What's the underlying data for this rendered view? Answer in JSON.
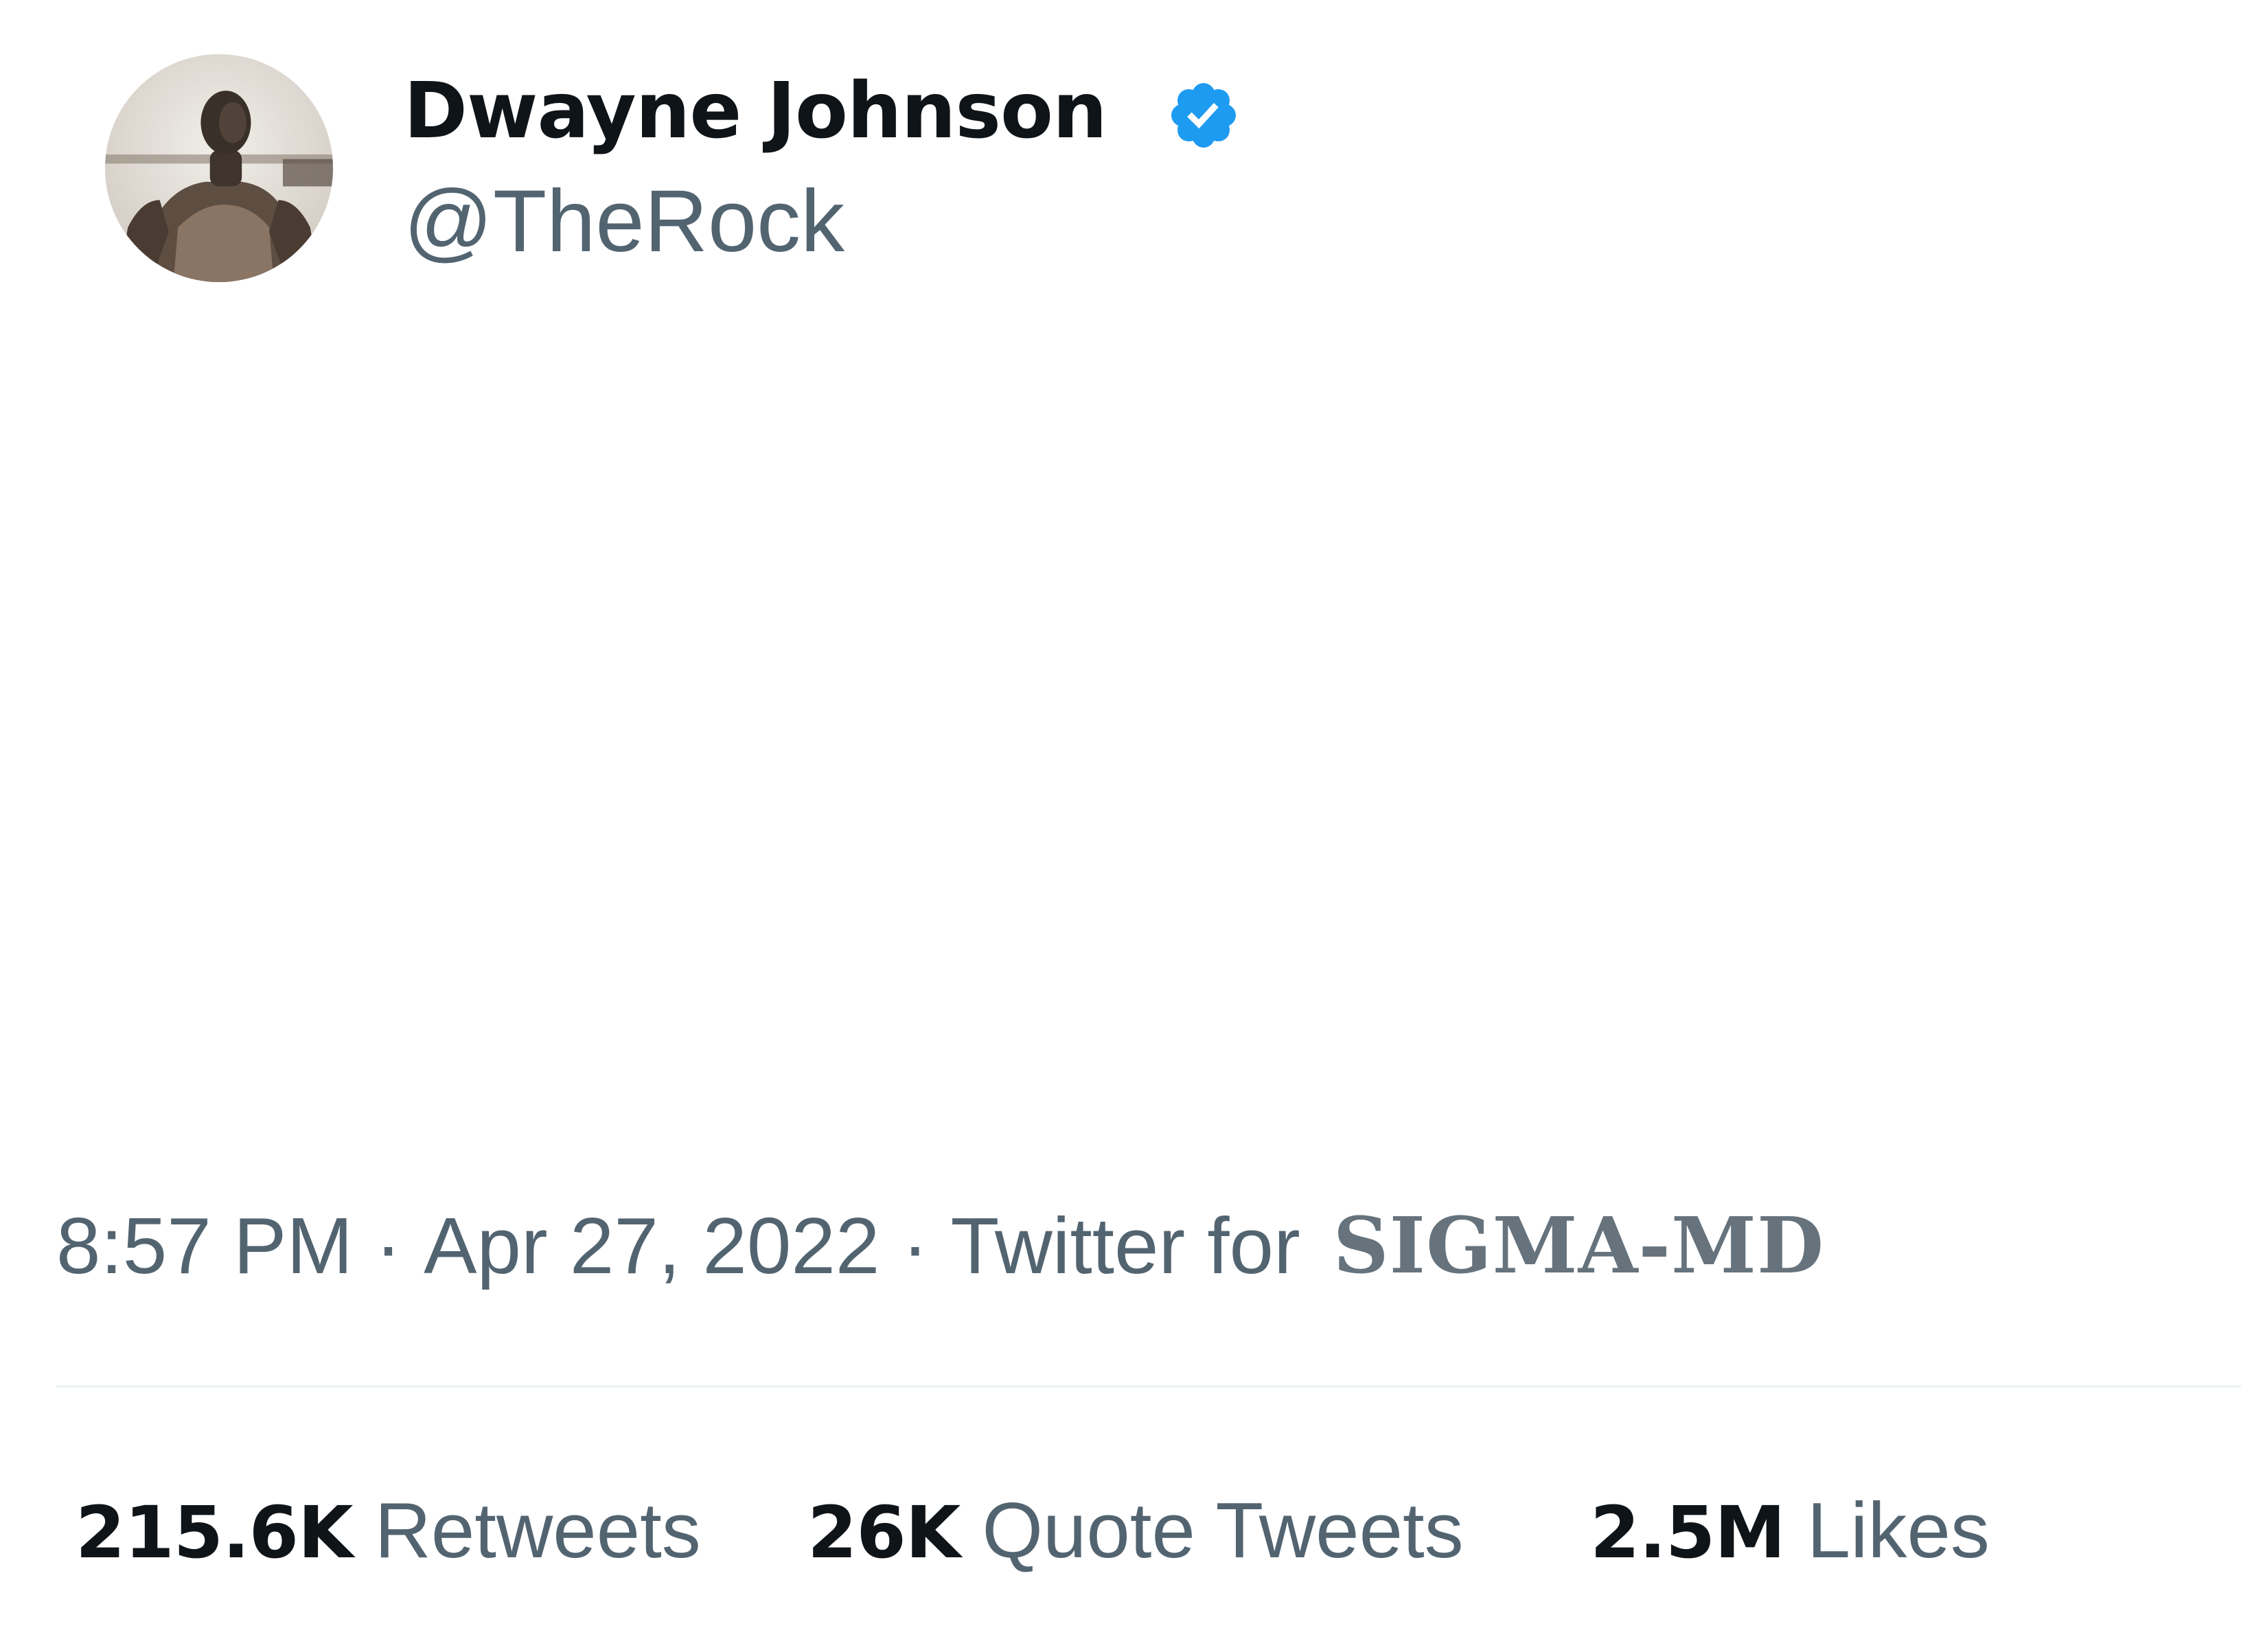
{
  "tweet": {
    "author": {
      "display_name": "Dwayne Johnson",
      "handle": "@TheRock",
      "verified": true,
      "badge_icon": "verified-badge-icon",
      "badge_color": "#1d9bf0"
    },
    "meta": {
      "time": "8:57 PM",
      "separator": "·",
      "date": "Apr 27, 2022",
      "source_prefix": "Twitter for",
      "source_name": "SIGMA-MD"
    },
    "stats": [
      {
        "count": "215.6K",
        "label": "Retweets"
      },
      {
        "count": "26K",
        "label": "Quote Tweets"
      },
      {
        "count": "2.5M",
        "label": "Likes"
      }
    ]
  },
  "colors": {
    "primary_text": "#0f1419",
    "secondary_text": "#536471",
    "divider": "#eff3f4",
    "background": "#ffffff"
  }
}
